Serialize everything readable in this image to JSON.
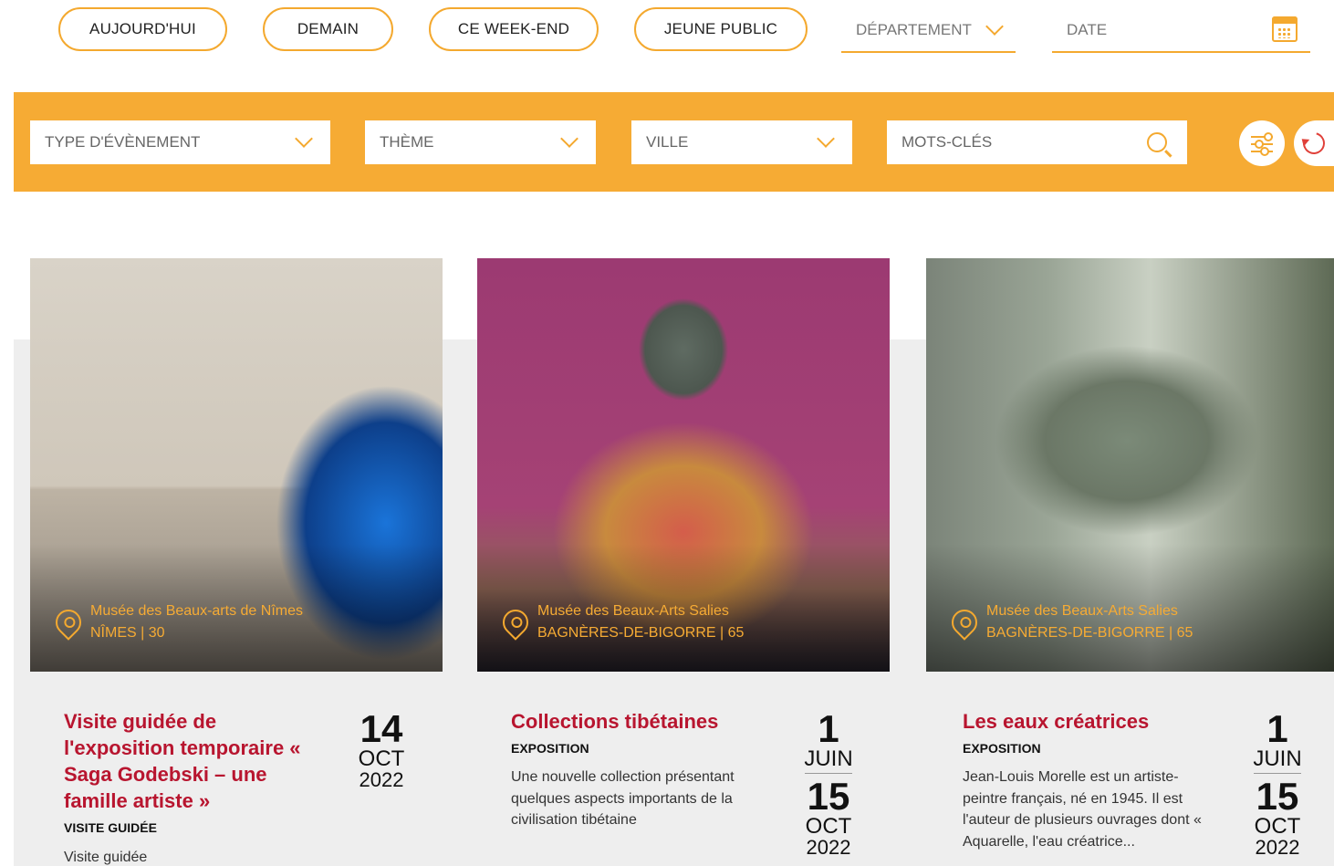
{
  "quick_filters": {
    "today": "AUJOURD'HUI",
    "tomorrow": "DEMAIN",
    "weekend": "CE WEEK-END",
    "young": "JEUNE PUBLIC",
    "department": "DÉPARTEMENT",
    "date": "DATE"
  },
  "filters": {
    "event_type": "TYPE D'ÉVÈNEMENT",
    "theme": "THÈME",
    "city": "VILLE",
    "keywords_placeholder": "MOTS-CLÉS"
  },
  "colors": {
    "accent": "#f6ab34",
    "title": "#b8152f",
    "card_bg": "#eeeeee"
  },
  "icons": {
    "department": "chevron-down-icon",
    "date": "calendar-icon",
    "search": "search-icon",
    "advanced": "sliders-icon",
    "reset": "reset-icon",
    "location": "map-pin-icon"
  },
  "cards": [
    {
      "venue": "Musée des Beaux-arts de Nîmes",
      "city": "NÎMES | 30",
      "title": "Visite guidée de l'exposition temporaire « Saga Godebski – une famille artiste »",
      "type": "VISITE GUIDÉE",
      "desc": "Visite guidée",
      "start": {
        "day": "14",
        "month": "OCT",
        "year": "2022"
      }
    },
    {
      "venue": "Musée des Beaux-Arts Salies",
      "city": "BAGNÈRES-DE-BIGORRE | 65",
      "title": "Collections tibétaines",
      "type": "EXPOSITION",
      "desc": "Une nouvelle collection présentant quelques aspects importants de la civilisation tibétaine",
      "start": {
        "day": "1",
        "month": "JUIN"
      },
      "end": {
        "day": "15",
        "month": "OCT",
        "year": "2022"
      }
    },
    {
      "venue": "Musée des Beaux-Arts Salies",
      "city": "BAGNÈRES-DE-BIGORRE | 65",
      "title": "Les eaux créatrices",
      "type": "EXPOSITION",
      "desc": "Jean-Louis Morelle est un artiste-peintre français, né en 1945. Il est l'auteur de plusieurs ouvrages dont « Aquarelle, l'eau créatrice...",
      "start": {
        "day": "1",
        "month": "JUIN"
      },
      "end": {
        "day": "15",
        "month": "OCT",
        "year": "2022"
      }
    }
  ]
}
